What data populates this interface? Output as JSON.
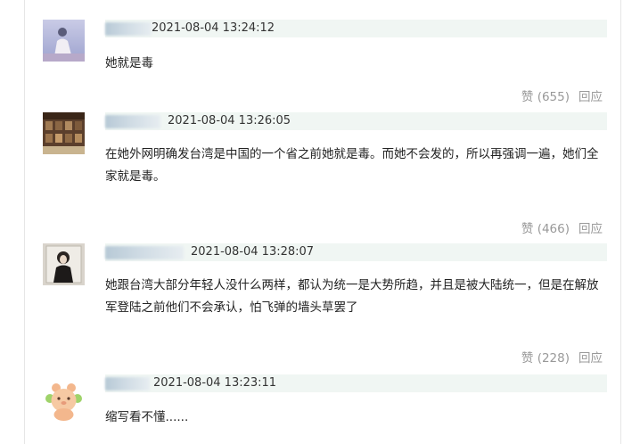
{
  "comments": [
    {
      "time": "2021-08-04 13:24:12",
      "text": "她就是毒",
      "likes": "赞 (655)",
      "reply": "回应"
    },
    {
      "time": "2021-08-04 13:26:05",
      "text": "在她外网明确发台湾是中国的一个省之前她就是毒。而她不会发的，所以再强调一遍，她们全家就是毒。",
      "likes": "赞 (466)",
      "reply": "回应"
    },
    {
      "time": "2021-08-04 13:28:07",
      "text": "她跟台湾大部分年轻人没什么两样，都认为统一是大势所趋，并且是被大陆统一，但是在解放军登陆之前他们不会承认，怕飞弹的墙头草罢了",
      "likes": "赞 (228)",
      "reply": "回应"
    },
    {
      "time": "2021-08-04 13:23:11",
      "text": "缩写看不懂......",
      "likes": "",
      "reply": ""
    }
  ]
}
